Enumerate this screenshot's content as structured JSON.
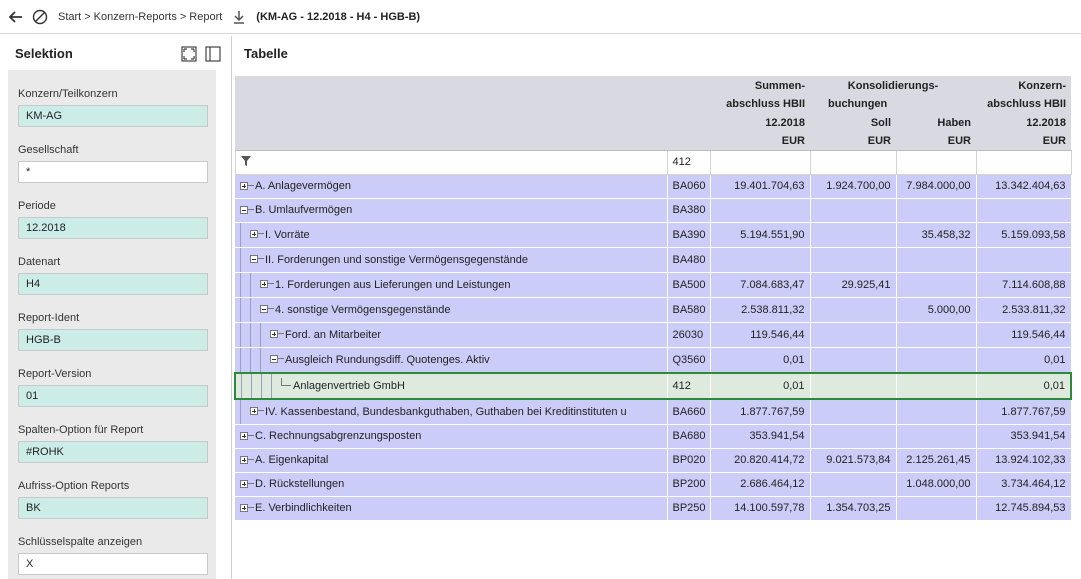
{
  "breadcrumb": {
    "items": [
      "Start",
      "Konzern-Reports",
      "Report"
    ],
    "separator": ">",
    "report_id": "(KM-AG - 12.2018 - H4 - HGB-B)"
  },
  "selection": {
    "title": "Selektion",
    "fields": [
      {
        "label": "Konzern/Teilkonzern",
        "value": "KM-AG",
        "style": "teal"
      },
      {
        "label": "Gesellschaft",
        "value": "*",
        "style": "white"
      },
      {
        "label": "Periode",
        "value": "12.2018",
        "style": "teal"
      },
      {
        "label": "Datenart",
        "value": "H4",
        "style": "teal"
      },
      {
        "label": "Report-Ident",
        "value": "HGB-B",
        "style": "teal"
      },
      {
        "label": "Report-Version",
        "value": "01",
        "style": "teal"
      },
      {
        "label": "Spalten-Option für Report",
        "value": "#ROHK",
        "style": "teal"
      },
      {
        "label": "Aufriss-Option Reports",
        "value": "BK",
        "style": "teal"
      },
      {
        "label": "Schlüsselspalte anzeigen",
        "value": "X",
        "style": "white"
      }
    ]
  },
  "table": {
    "title": "Tabelle",
    "headers": {
      "summen_1": "Summen-",
      "summen_2": "abschluss HBII",
      "kons_1": "Konsolidierungs-",
      "kons_2": "buchungen",
      "konzern_1": "Konzern-",
      "konzern_2": "abschluss HBII",
      "period": "12.2018",
      "soll": "Soll",
      "haben": "Haben",
      "currency": "EUR"
    },
    "filter_value": "412",
    "rows": [
      {
        "indent": 0,
        "tree": "plus",
        "label": "A. Anlagevermögen",
        "key": "BA060",
        "summen": "19.401.704,63",
        "soll": "1.924.700,00",
        "haben": "7.984.000,00",
        "konzern": "13.342.404,63"
      },
      {
        "indent": 0,
        "tree": "minus",
        "label": "B. Umlaufvermögen",
        "key": "BA380",
        "summen": "",
        "soll": "",
        "haben": "",
        "konzern": ""
      },
      {
        "indent": 1,
        "tree": "plus",
        "label": "I. Vorräte",
        "key": "BA390",
        "summen": "5.194.551,90",
        "soll": "",
        "haben": "35.458,32",
        "konzern": "5.159.093,58"
      },
      {
        "indent": 1,
        "tree": "minus",
        "label": "II. Forderungen und sonstige Vermögensgegenstände",
        "key": "BA480",
        "summen": "",
        "soll": "",
        "haben": "",
        "konzern": ""
      },
      {
        "indent": 2,
        "tree": "plus",
        "label": "1. Forderungen aus Lieferungen und Leistungen",
        "key": "BA500",
        "summen": "7.084.683,47",
        "soll": "29.925,41",
        "haben": "",
        "konzern": "7.114.608,88"
      },
      {
        "indent": 2,
        "tree": "minus",
        "label": "4. sonstige Vermögensgegenstände",
        "key": "BA580",
        "summen": "2.538.811,32",
        "soll": "",
        "haben": "5.000,00",
        "konzern": "2.533.811,32"
      },
      {
        "indent": 3,
        "tree": "plus",
        "label": "Ford. an Mitarbeiter",
        "key": "26030",
        "summen": "119.546,44",
        "soll": "",
        "haben": "",
        "konzern": "119.546,44"
      },
      {
        "indent": 3,
        "tree": "minus",
        "label": "Ausgleich Rundungsdiff. Quotenges. Aktiv",
        "key": "Q3560",
        "summen": "0,01",
        "soll": "",
        "haben": "",
        "konzern": "0,01"
      },
      {
        "indent": 4,
        "tree": "leaf",
        "label": "Anlagenvertrieb GmbH",
        "key": "412",
        "summen": "0,01",
        "soll": "",
        "haben": "",
        "konzern": "0,01",
        "selected": true
      },
      {
        "indent": 1,
        "tree": "plus",
        "label": "IV. Kassenbestand, Bundesbankguthaben, Guthaben bei Kreditinstituten u",
        "key": "BA660",
        "summen": "1.877.767,59",
        "soll": "",
        "haben": "",
        "konzern": "1.877.767,59"
      },
      {
        "indent": 0,
        "tree": "plus",
        "label": "C. Rechnungsabgrenzungsposten",
        "key": "BA680",
        "summen": "353.941,54",
        "soll": "",
        "haben": "",
        "konzern": "353.941,54"
      },
      {
        "indent": 0,
        "tree": "plus",
        "label": "A. Eigenkapital",
        "key": "BP020",
        "summen": "20.820.414,72",
        "soll": "9.021.573,84",
        "haben": "2.125.261,45",
        "konzern": "13.924.102,33"
      },
      {
        "indent": 0,
        "tree": "plus",
        "label": "D. Rückstellungen",
        "key": "BP200",
        "summen": "2.686.464,12",
        "soll": "",
        "haben": "1.048.000,00",
        "konzern": "3.734.464,12"
      },
      {
        "indent": 0,
        "tree": "plus",
        "label": "E. Verbindlichkeiten",
        "key": "BP250",
        "summen": "14.100.597,78",
        "soll": "1.354.703,25",
        "haben": "",
        "konzern": "12.745.894,53"
      }
    ]
  },
  "colors": {
    "row_bg": "#ccccf8",
    "field_bg": "#ccece8",
    "selected_border": "#2d8a3a"
  }
}
